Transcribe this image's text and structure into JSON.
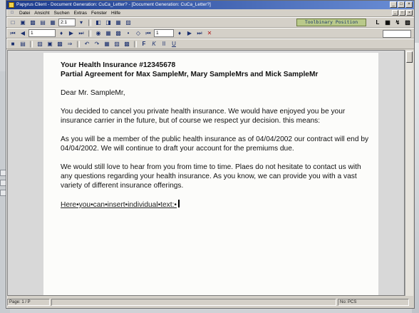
{
  "window": {
    "title": "Papyrus Client - Document Generation: CuCa_Letter? - [Document Generation: CuCa_Letter?]",
    "controls": [
      "_",
      "□",
      "×"
    ]
  },
  "menubar": {
    "items": [
      "Datei",
      "Ansicht",
      "Suchen",
      "Extras",
      "Fenster",
      "Hilfe"
    ],
    "mdi_controls": [
      "_",
      "□",
      "×"
    ]
  },
  "toolbar1": {
    "zoom_value": "2:1",
    "font_name": "Toolbinary Position"
  },
  "toolbar2": {
    "page_value": "1",
    "page_value2": "1"
  },
  "document": {
    "heading_line1": "Your Health Insurance #12345678",
    "heading_line2": "Partial Agreement for Max SampleMr, Mary SampleMrs and Mick SampleMr",
    "salutation": "Dear Mr. SampleMr,",
    "para1": "You decided to cancel you private health insurance. We would have enjoyed you be your insurance carrier in the future, but of course we respect yur decision. this means:",
    "para2": "As you will be a member of the public health insurance as of 04/04/2002 our contract will end by 04/04/2002. We will continue to draft your account for the premiums due.",
    "para3": "We would still love to hear from you from time to time. Plaes do not hesitate to contact us with any questions regarding your health insurance. As you know, we can provide you with a vast variety of different insurance offerings.",
    "insert_text": "Here•you•can•insert•individual•text:•"
  },
  "statusbar": {
    "page": "Page: 1 / P",
    "mode": "No: PCS"
  },
  "colors": {
    "title_bar": "#1b3a8c",
    "font_combo_bg": "#b9c98a",
    "page_bg": "#fcfcfa",
    "delete_icon": "#b01818"
  }
}
